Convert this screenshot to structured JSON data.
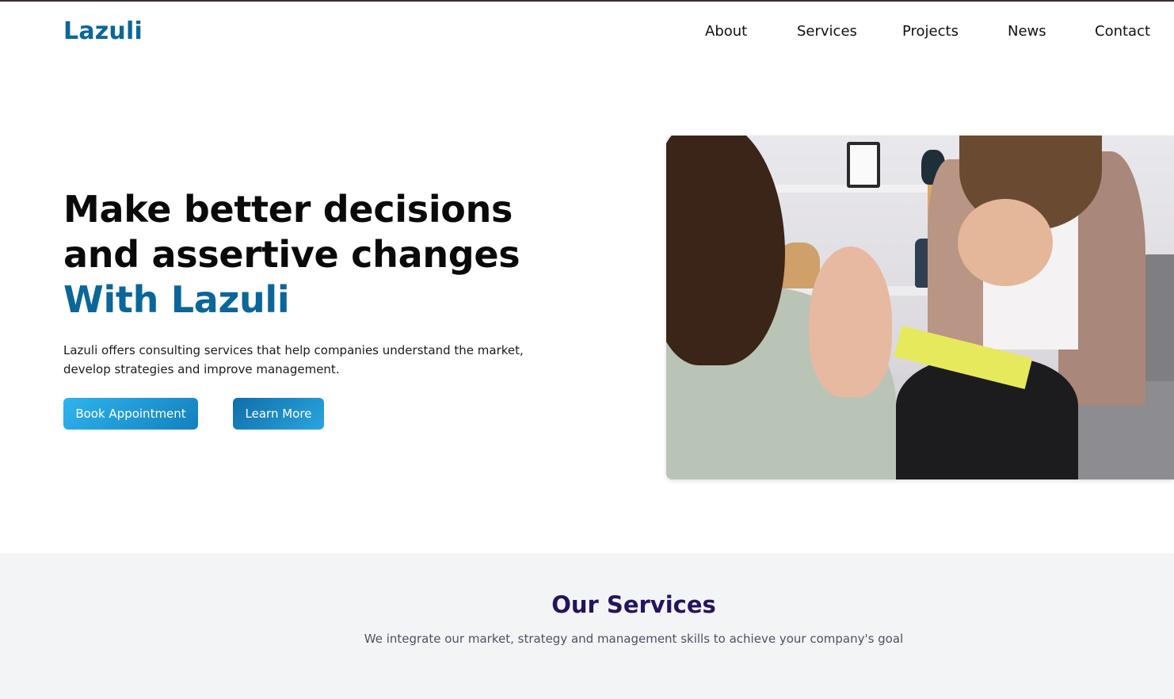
{
  "brand": {
    "logo": "Lazuli",
    "accent_color": "#0b6699"
  },
  "nav": {
    "items": [
      {
        "label": "About"
      },
      {
        "label": "Services"
      },
      {
        "label": "Projects"
      },
      {
        "label": "News"
      },
      {
        "label": "Contact"
      }
    ]
  },
  "hero": {
    "title_line1": "Make better decisions",
    "title_line2": "and assertive changes",
    "title_accent": "With Lazuli",
    "description_line1": "Lazuli offers consulting services that help companies understand the market,",
    "description_line2": "develop strategies and improve management.",
    "book_button": "Book Appointment",
    "learn_button": "Learn More",
    "image_alt": "Two women talking in a consulting session"
  },
  "services": {
    "title": "Our Services",
    "subtitle": "We integrate our market, strategy and management skills to achieve your company's goal",
    "title_color": "#25145c",
    "background_color": "#f3f4f6"
  }
}
